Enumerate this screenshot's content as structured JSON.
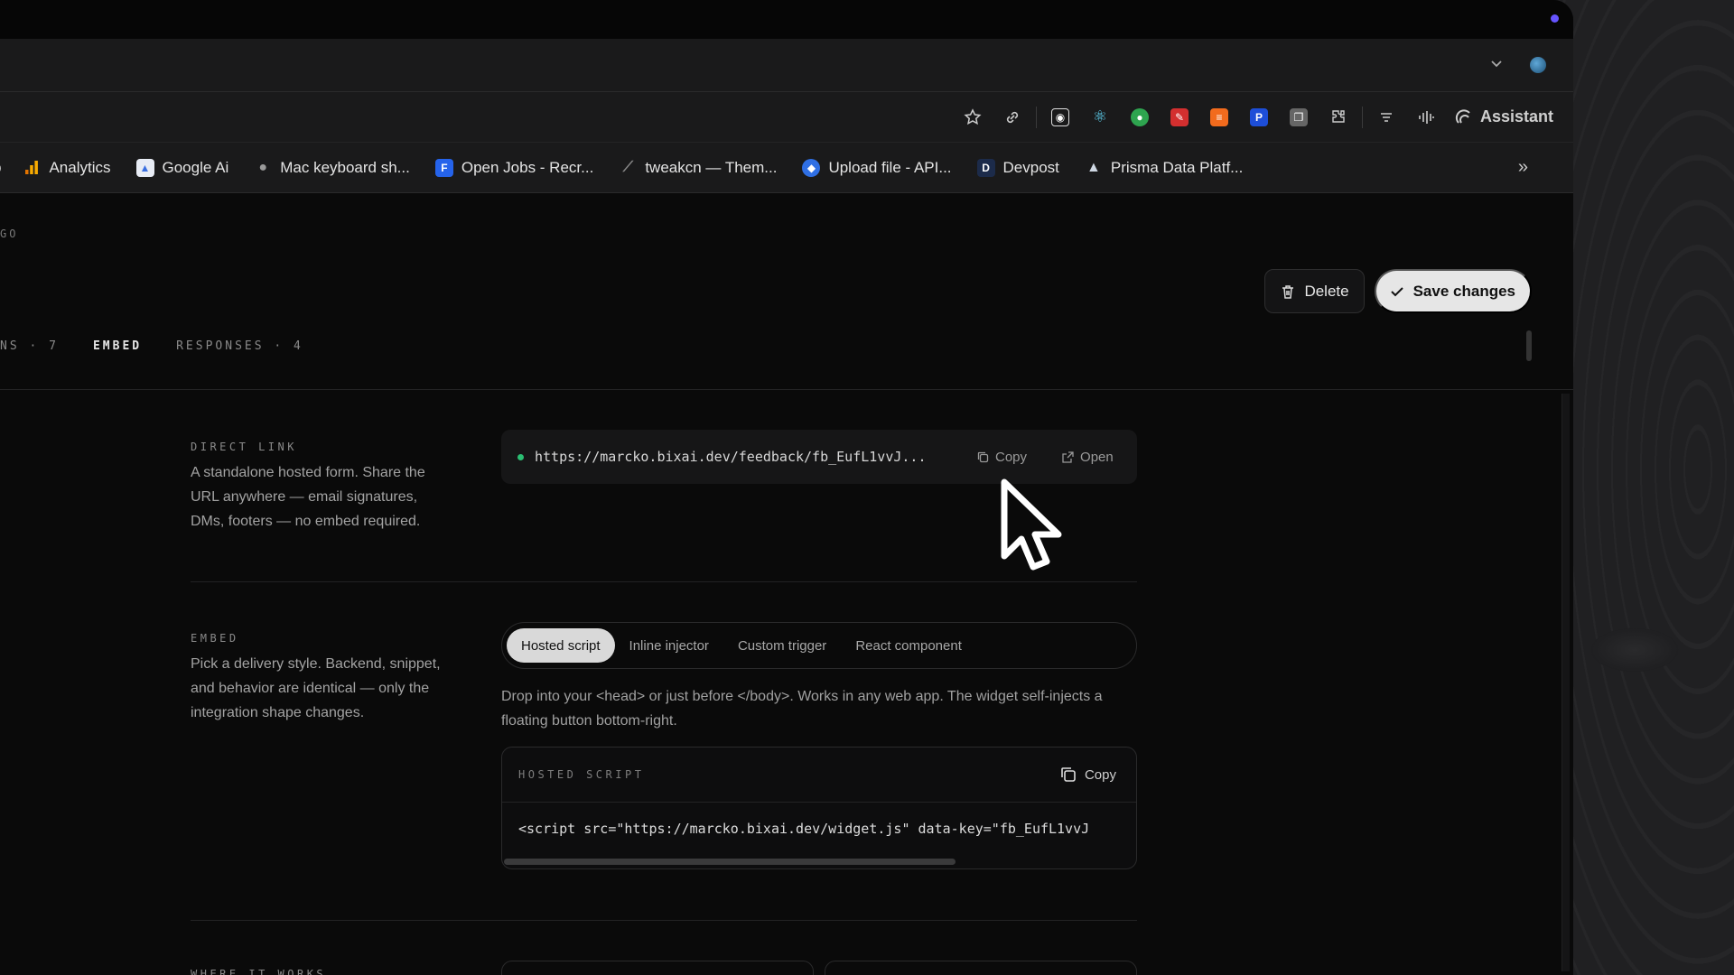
{
  "browser": {
    "toolbar": {
      "assistant_label": "Assistant"
    },
    "bookmarks": [
      {
        "label": "Analytics",
        "icon": "analytics-icon",
        "color": "#f29900"
      },
      {
        "label": "Google Ai",
        "icon": "google-ai-icon",
        "color": "#3b6fe0"
      },
      {
        "label": "Mac keyboard sh...",
        "icon": "apple-icon",
        "color": "#9a9a9a"
      },
      {
        "label": "Open Jobs - Recr...",
        "icon": "jobs-icon",
        "color": "#2563eb"
      },
      {
        "label": "tweakcn — Them...",
        "icon": "tweakcn-icon",
        "color": "#333333"
      },
      {
        "label": "Upload file - API...",
        "icon": "upload-icon",
        "color": "#2f6fe4"
      },
      {
        "label": "Devpost",
        "icon": "devpost-icon",
        "color": "#1c2b4a"
      },
      {
        "label": "Prisma Data Platf...",
        "icon": "prisma-icon",
        "color": "#cfd8e3"
      }
    ]
  },
  "page": {
    "breadcrumb": "GO",
    "delete_label": "Delete",
    "save_label": "Save changes",
    "tabs": [
      {
        "label": "NS · 7"
      },
      {
        "label": "EMBED"
      },
      {
        "label": "RESPONSES · 4"
      }
    ],
    "direct_link": {
      "label": "DIRECT LINK",
      "description": "A standalone hosted form. Share the URL anywhere — email signatures, DMs, footers — no embed required.",
      "url": "https://marcko.bixai.dev/feedback/fb_EufL1vvJ...",
      "copy_label": "Copy",
      "open_label": "Open"
    },
    "embed": {
      "label": "EMBED",
      "description": "Pick a delivery style. Backend, snippet, and behavior are identical — only the integration shape changes.",
      "options": [
        "Hosted script",
        "Inline injector",
        "Custom trigger",
        "React component"
      ],
      "selected": "Hosted script",
      "hint": "Drop into your <head> or just before </body>. Works in any web app. The widget self-injects a floating button bottom-right.",
      "code_label": "HOSTED SCRIPT",
      "copy_label": "Copy",
      "code": "<script src=\"https://marcko.bixai.dev/widget.js\" data-key=\"fb_EufL1vvJ"
    },
    "where_it_works": {
      "label": "WHERE IT WORKS"
    }
  }
}
